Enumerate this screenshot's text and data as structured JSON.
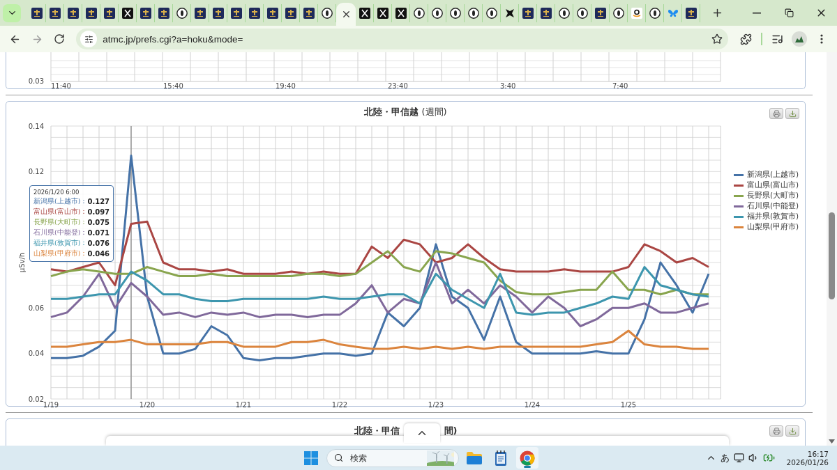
{
  "browser": {
    "tabs": [
      {
        "kind": "site",
        "selected": false
      },
      {
        "kind": "site",
        "selected": false
      },
      {
        "kind": "site",
        "selected": false
      },
      {
        "kind": "site",
        "selected": false
      },
      {
        "kind": "site",
        "selected": false
      },
      {
        "kind": "x",
        "selected": false
      },
      {
        "kind": "site",
        "selected": false
      },
      {
        "kind": "site",
        "selected": false
      },
      {
        "kind": "circle",
        "selected": false
      },
      {
        "kind": "site",
        "selected": false
      },
      {
        "kind": "site",
        "selected": false
      },
      {
        "kind": "site",
        "selected": false
      },
      {
        "kind": "site",
        "selected": false
      },
      {
        "kind": "site",
        "selected": false
      },
      {
        "kind": "site",
        "selected": false
      },
      {
        "kind": "site",
        "selected": false
      },
      {
        "kind": "circle",
        "selected": false
      },
      {
        "kind": "blank",
        "selected": true
      },
      {
        "kind": "x",
        "selected": false
      },
      {
        "kind": "x",
        "selected": false
      },
      {
        "kind": "x",
        "selected": false
      },
      {
        "kind": "circle",
        "selected": false
      },
      {
        "kind": "circle",
        "selected": false
      },
      {
        "kind": "circle",
        "selected": false
      },
      {
        "kind": "circle",
        "selected": false
      },
      {
        "kind": "circle",
        "selected": false
      },
      {
        "kind": "star",
        "selected": false
      },
      {
        "kind": "site",
        "selected": false
      },
      {
        "kind": "site",
        "selected": false
      },
      {
        "kind": "circle",
        "selected": false
      },
      {
        "kind": "circle",
        "selected": false
      },
      {
        "kind": "site",
        "selected": false
      },
      {
        "kind": "circle",
        "selected": false
      },
      {
        "kind": "amazon",
        "selected": false
      },
      {
        "kind": "circle",
        "selected": false
      },
      {
        "kind": "butterfly",
        "selected": false
      },
      {
        "kind": "site",
        "selected": false
      }
    ],
    "url": "atmc.jp/prefs.cgi?a=hoku&mode="
  },
  "upper_chart": {
    "yticks": [
      "0.03"
    ],
    "xticks": [
      "11:40",
      "15:40",
      "19:40",
      "23:40",
      "3:40",
      "7:40"
    ]
  },
  "main_panel": {
    "title": "**北陸・甲信越** (週間)",
    "chart_data": {
      "type": "line",
      "ylabel": "μSv/h",
      "ylim": [
        0.02,
        0.14
      ],
      "grid": true,
      "yticks": [
        0.02,
        0.04,
        0.06,
        0.12,
        0.14
      ],
      "categories": [
        "1/19",
        null,
        null,
        null,
        null,
        null,
        "1/20",
        null,
        null,
        null,
        null,
        null,
        "1/21",
        null,
        null,
        null,
        null,
        null,
        "1/22",
        null,
        null,
        null,
        null,
        null,
        "1/23",
        null,
        null,
        null,
        null,
        null,
        "1/24",
        null,
        null,
        null,
        null,
        null,
        "1/25",
        null,
        null,
        null,
        null,
        null
      ],
      "series": [
        {
          "name": "新潟県(上越市)",
          "color": "#4572a7",
          "values": [
            0.038,
            0.038,
            0.039,
            0.043,
            0.05,
            0.127,
            0.065,
            0.04,
            0.04,
            0.042,
            0.052,
            0.048,
            0.038,
            0.037,
            0.038,
            0.038,
            0.039,
            0.04,
            0.04,
            0.039,
            0.04,
            0.058,
            0.052,
            0.06,
            0.088,
            0.065,
            0.06,
            0.046,
            0.065,
            0.045,
            0.04,
            0.04,
            0.04,
            0.04,
            0.041,
            0.04,
            0.04,
            0.055,
            0.08,
            0.07,
            0.058,
            0.075
          ]
        },
        {
          "name": "富山県(富山市)",
          "color": "#aa4643",
          "values": [
            0.077,
            0.076,
            0.078,
            0.08,
            0.07,
            0.097,
            0.098,
            0.08,
            0.077,
            0.077,
            0.076,
            0.077,
            0.075,
            0.075,
            0.075,
            0.076,
            0.075,
            0.076,
            0.075,
            0.075,
            0.087,
            0.082,
            0.09,
            0.088,
            0.08,
            0.082,
            0.088,
            0.082,
            0.077,
            0.076,
            0.076,
            0.076,
            0.077,
            0.076,
            0.076,
            0.076,
            0.078,
            0.088,
            0.085,
            0.08,
            0.082,
            0.078
          ]
        },
        {
          "name": "長野県(大町市)",
          "color": "#89a54e",
          "values": [
            0.074,
            0.076,
            0.077,
            0.076,
            0.075,
            0.075,
            0.078,
            0.076,
            0.074,
            0.074,
            0.075,
            0.074,
            0.074,
            0.074,
            0.074,
            0.074,
            0.075,
            0.075,
            0.074,
            0.075,
            0.08,
            0.085,
            0.078,
            0.076,
            0.085,
            0.084,
            0.082,
            0.08,
            0.072,
            0.067,
            0.066,
            0.066,
            0.067,
            0.068,
            0.068,
            0.076,
            0.068,
            0.068,
            0.066,
            0.068,
            0.066,
            0.066
          ]
        },
        {
          "name": "石川県(中能登)",
          "color": "#80699b",
          "values": [
            0.056,
            0.058,
            0.065,
            0.075,
            0.06,
            0.071,
            0.065,
            0.057,
            0.058,
            0.056,
            0.058,
            0.057,
            0.058,
            0.056,
            0.057,
            0.057,
            0.056,
            0.057,
            0.057,
            0.062,
            0.07,
            0.058,
            0.064,
            0.062,
            0.08,
            0.062,
            0.068,
            0.062,
            0.07,
            0.065,
            0.058,
            0.065,
            0.06,
            0.052,
            0.055,
            0.06,
            0.06,
            0.062,
            0.058,
            0.058,
            0.06,
            0.062
          ]
        },
        {
          "name": "福井県(敦賀市)",
          "color": "#3d96ae",
          "values": [
            0.064,
            0.064,
            0.065,
            0.066,
            0.066,
            0.076,
            0.072,
            0.066,
            0.066,
            0.064,
            0.063,
            0.063,
            0.064,
            0.064,
            0.064,
            0.064,
            0.064,
            0.065,
            0.064,
            0.064,
            0.065,
            0.066,
            0.066,
            0.062,
            0.075,
            0.068,
            0.064,
            0.06,
            0.075,
            0.058,
            0.057,
            0.058,
            0.058,
            0.06,
            0.062,
            0.065,
            0.064,
            0.078,
            0.07,
            0.068,
            0.066,
            0.065
          ]
        },
        {
          "name": "山梨県(甲府市)",
          "color": "#db843d",
          "values": [
            0.043,
            0.043,
            0.044,
            0.045,
            0.045,
            0.046,
            0.044,
            0.044,
            0.044,
            0.044,
            0.045,
            0.045,
            0.043,
            0.043,
            0.043,
            0.045,
            0.045,
            0.046,
            0.044,
            0.043,
            0.042,
            0.042,
            0.043,
            0.042,
            0.043,
            0.042,
            0.043,
            0.042,
            0.043,
            0.043,
            0.043,
            0.043,
            0.043,
            0.043,
            0.044,
            0.045,
            0.05,
            0.044,
            0.043,
            0.043,
            0.042,
            0.042
          ]
        }
      ]
    },
    "tooltip": {
      "date": "2026/1/20 6:00",
      "rows": [
        {
          "label": "新潟県(上越市)：",
          "value": "0.127"
        },
        {
          "label": "富山県(富山市)：",
          "value": "0.097"
        },
        {
          "label": "長野県(大町市)：",
          "value": "0.075"
        },
        {
          "label": "石川県(中能登)：",
          "value": "0.071"
        },
        {
          "label": "福井県(敦賀市)：",
          "value": "0.076"
        },
        {
          "label": "山梨県(甲府市)：",
          "value": "0.046"
        }
      ]
    }
  },
  "lower_panel": {
    "title_parts": [
      "北陸・甲信",
      "間)"
    ]
  },
  "taskbar": {
    "search": {
      "placeholder": "検索"
    },
    "ime": "あ",
    "time": "16:17",
    "date": "2026/01/26"
  }
}
